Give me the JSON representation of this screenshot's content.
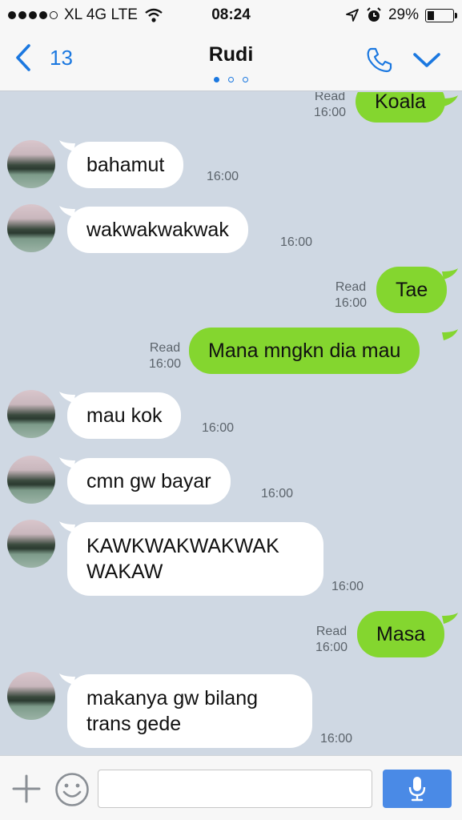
{
  "status_bar": {
    "carrier": "XL 4G LTE",
    "time": "08:24",
    "battery": "29%",
    "battery_level": 0.29
  },
  "nav": {
    "back_count": "13",
    "title": "Rudi",
    "page_dots": 3,
    "active_dot": 0
  },
  "messages": [
    {
      "dir": "out",
      "text": "Koala",
      "read": "Read",
      "time": "16:00"
    },
    {
      "dir": "in",
      "text": "bahamut",
      "time": "16:00"
    },
    {
      "dir": "in",
      "text": "wakwakwakwak",
      "time": "16:00"
    },
    {
      "dir": "out",
      "text": "Tae",
      "read": "Read",
      "time": "16:00"
    },
    {
      "dir": "out",
      "text": "Mana mngkn dia mau",
      "read": "Read",
      "time": "16:00"
    },
    {
      "dir": "in",
      "text": "mau kok",
      "time": "16:00"
    },
    {
      "dir": "in",
      "text": "cmn gw bayar",
      "time": "16:00"
    },
    {
      "dir": "in",
      "text": "KAWKWAKWAKWAK WAKAW",
      "time": "16:00"
    },
    {
      "dir": "out",
      "text": "Masa",
      "read": "Read",
      "time": "16:00"
    },
    {
      "dir": "in",
      "text": "makanya gw bilang trans gede",
      "time": "16:00"
    }
  ],
  "input": {
    "value": "",
    "placeholder": ""
  },
  "colors": {
    "accent": "#1b78e0",
    "outgoing_bubble": "#84d62f",
    "incoming_bubble": "#ffffff",
    "chat_background": "#cfd8e3",
    "mic_button": "#4a8ae6"
  },
  "icons": {
    "back": "chevron-left-icon",
    "call": "phone-icon",
    "menu": "chevron-down-icon",
    "add": "plus-icon",
    "emoji": "smiley-icon",
    "voice": "microphone-icon",
    "wifi": "wifi-icon",
    "location": "location-arrow-icon",
    "alarm": "alarm-icon"
  }
}
